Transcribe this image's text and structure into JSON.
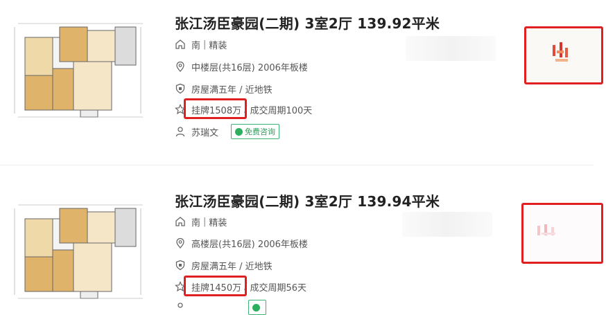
{
  "listings": [
    {
      "title": "张江汤臣豪园(二期) 3室2厅 139.92平米",
      "orientation": "南",
      "decoration": "精装",
      "floor_info": "中楼层(共16层) 2006年板楼",
      "tags": "房屋满五年 / 近地铁",
      "list_price": "挂牌1508万",
      "deal_cycle": "成交周期100天",
      "agent": "苏瑞文",
      "consult_label": "免费咨询"
    },
    {
      "title": "张江汤臣豪园(二期) 3室2厅 139.94平米",
      "orientation": "南",
      "decoration": "精装",
      "floor_info": "高楼层(共16层) 2006年板楼",
      "tags": "房屋满五年 / 近地铁",
      "list_price": "挂牌1450万",
      "deal_cycle": "成交周期56天",
      "agent": "",
      "consult_label": ""
    }
  ],
  "separator": "|",
  "slash": "/",
  "icons": {
    "house": "house-icon",
    "location": "location-pin-icon",
    "shield": "shield-icon",
    "star": "star-icon",
    "person": "person-icon",
    "chat": "chat-bubble-icon"
  },
  "colors": {
    "highlight_border": "#e02020",
    "consult_green": "#2eaf5f"
  }
}
